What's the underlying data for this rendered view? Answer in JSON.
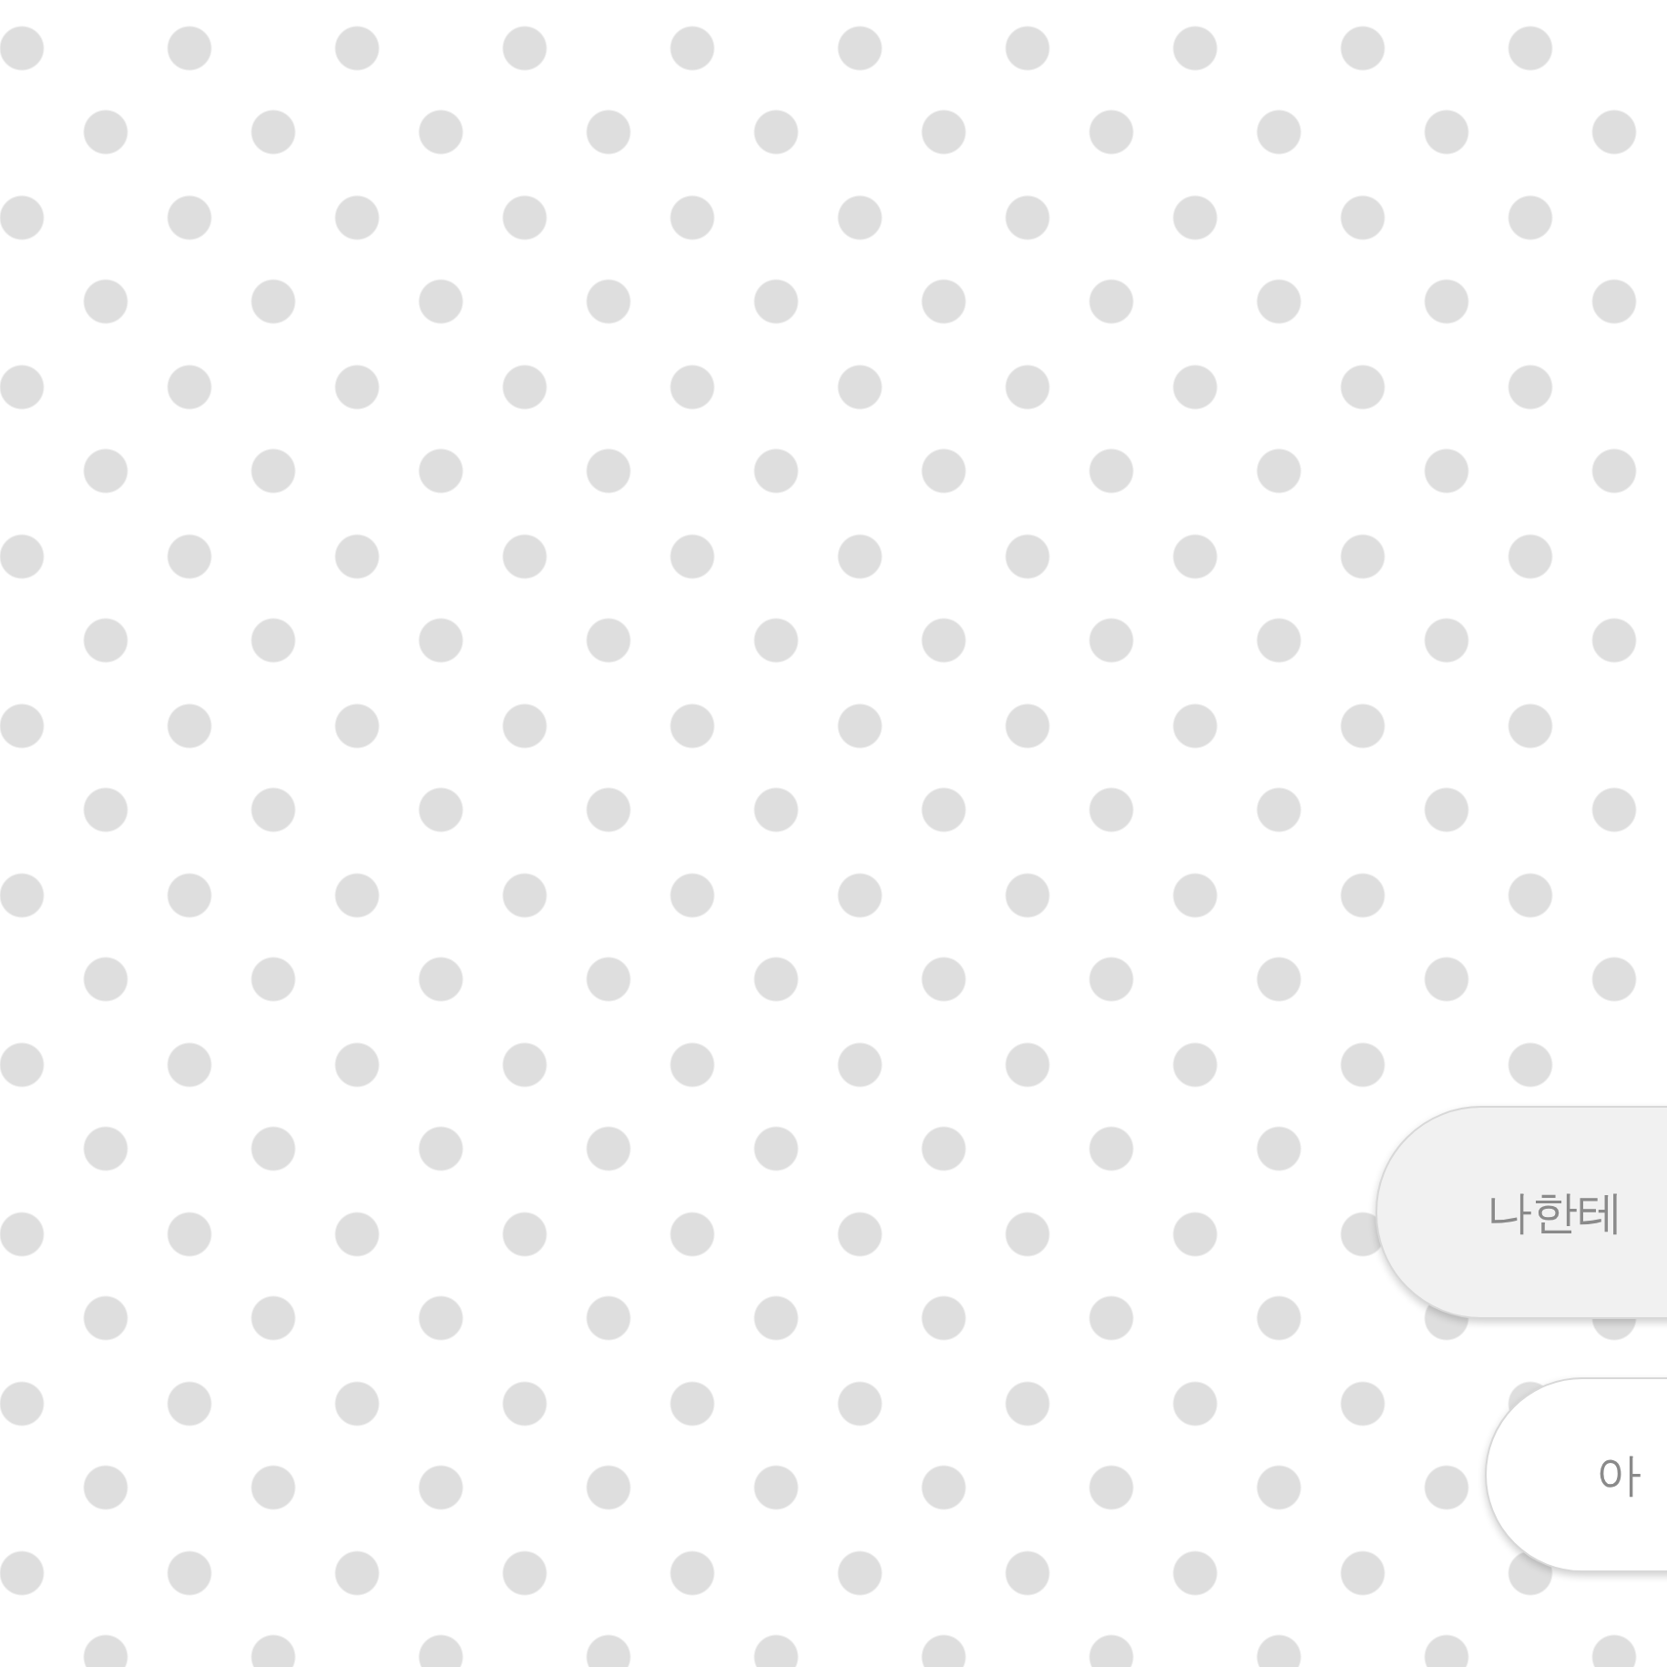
{
  "choices": [
    {
      "label": "나한테"
    },
    {
      "label": "아"
    }
  ]
}
